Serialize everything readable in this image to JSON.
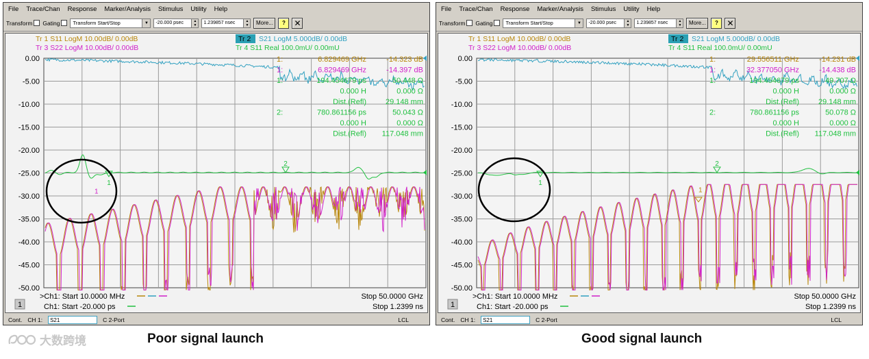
{
  "menu": [
    "File",
    "Trace/Chan",
    "Response",
    "Marker/Analysis",
    "Stimulus",
    "Utility",
    "Help"
  ],
  "toolbar": {
    "transform_label": "Transform",
    "gating_label": "Gating",
    "mode_select": "Transform Start/Stop",
    "start_value": "-20.000 psec",
    "stop_value": "1.239857 nsec",
    "more_label": "More...",
    "help_label": "?",
    "close_label": "✕"
  },
  "status": {
    "cont": "Cont.",
    "ch": "CH 1:",
    "param": "S21",
    "port": "C 2-Port",
    "lcl": "LCL"
  },
  "channel_number": "1",
  "y_ticks": [
    "0.00",
    "-5.00",
    "-10.00",
    "-15.00",
    "-20.00",
    "-25.00",
    "-30.00",
    "-35.00",
    "-40.00",
    "-45.00",
    "-50.00"
  ],
  "trace_labels": {
    "tr1": "Tr 1  S11 LogM 10.00dB/  0.00dB",
    "tr3": "Tr 3  S22 LogM 10.00dB/  0.00dB",
    "tr2_box": "Tr 2",
    "tr2": "S21 LogM 5.000dB/  0.00dB",
    "tr4": "Tr 4  S11 Real 100.0mU/  0.00mU"
  },
  "footer": {
    "ch1_freq": ">Ch1: Start  10.0000 MHz",
    "ch1_time": "Ch1: Start  -20.000 ps",
    "stop_freq": "Stop  50.0000 GHz",
    "stop_time": "Stop  1.2399 ns"
  },
  "panels": [
    {
      "caption": "Poor signal launch",
      "markers": [
        [
          "1:",
          "6.829469 GHz",
          "-14.323 dB"
        ],
        [
          "1:",
          "6.829469 GHz",
          "-14.397 dB"
        ],
        [
          "1:",
          "194.454679 ps",
          "50.448 Ω"
        ],
        [
          "",
          "0.000 H",
          "0.000 Ω"
        ],
        [
          "",
          "Dist.(Refl)",
          "29.148 mm"
        ],
        [
          "2:",
          "780.861156 ps",
          "50.043 Ω"
        ],
        [
          "",
          "0.000 H",
          "0.000 Ω"
        ],
        [
          "",
          "Dist.(Refl)",
          "117.048 mm"
        ]
      ]
    },
    {
      "caption": "Good signal launch",
      "markers": [
        [
          "1:",
          "29.556511 GHz",
          "-14.231 dB"
        ],
        [
          "1:",
          "32.377050 GHz",
          "-14.438 dB"
        ],
        [
          "1:",
          "194.454679 ps",
          "49.707 Ω"
        ],
        [
          "",
          "0.000 H",
          "0.000 Ω"
        ],
        [
          "",
          "Dist.(Refl)",
          "29.148 mm"
        ],
        [
          "2:",
          "780.861156 ps",
          "50.078 Ω"
        ],
        [
          "",
          "0.000 H",
          "0.000 Ω"
        ],
        [
          "",
          "Dist.(Refl)",
          "117.048 mm"
        ]
      ]
    }
  ],
  "marker_flags": [
    "1",
    "2"
  ],
  "logo_text": "大数跨境",
  "colors": {
    "tr1": "#b8860b",
    "tr3": "#d020c8",
    "tr2": "#30a0c0",
    "tr4": "#20c040",
    "grid": "#9a9a9a"
  }
}
